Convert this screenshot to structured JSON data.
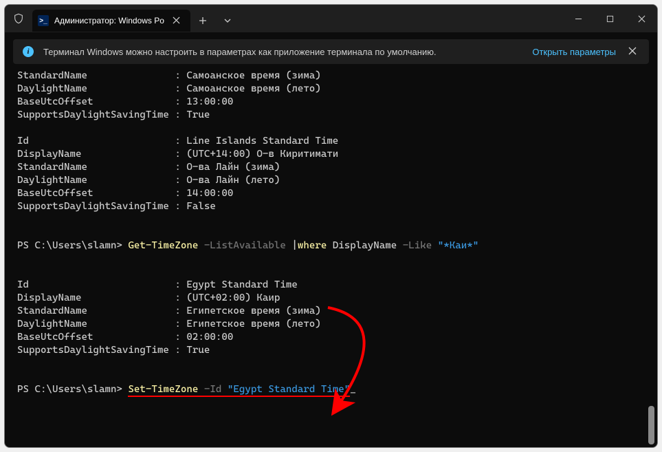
{
  "titlebar": {
    "tab_title": "Администратор: Windows Po",
    "tab_icon_glyph": ">_"
  },
  "banner": {
    "message": "Терминал Windows можно настроить в параметрах как приложение терминала по умолчанию.",
    "link": "Открыть параметры"
  },
  "terminal": {
    "block1": {
      "l1_k": "StandardName",
      "l1_v": "Самоанское время (зима)",
      "l2_k": "DaylightName",
      "l2_v": "Самоанское время (лето)",
      "l3_k": "BaseUtcOffset",
      "l3_v": "13:00:00",
      "l4_k": "SupportsDaylightSavingTime",
      "l4_v": "True"
    },
    "block2": {
      "l1_k": "Id",
      "l1_v": "Line Islands Standard Time",
      "l2_k": "DisplayName",
      "l2_v": "(UTC+14:00) О-в Киритимати",
      "l3_k": "StandardName",
      "l3_v": "О-ва Лайн (зима)",
      "l4_k": "DaylightName",
      "l4_v": "О-ва Лайн (лето)",
      "l5_k": "BaseUtcOffset",
      "l5_v": "14:00:00",
      "l6_k": "SupportsDaylightSavingTime",
      "l6_v": "False"
    },
    "cmd1": {
      "prompt": "PS C:\\Users\\slamn> ",
      "cmd": "Get-TimeZone",
      "arg1": " -ListAvailable ",
      "pipe": "|",
      "where": "where",
      "prop": " DisplayName ",
      "like": "-Like ",
      "str": "\"*Каи*\""
    },
    "block3": {
      "l1_k": "Id",
      "l1_v": "Egypt Standard Time",
      "l2_k": "DisplayName",
      "l2_v": "(UTC+02:00) Каир",
      "l3_k": "StandardName",
      "l3_v": "Египетское время (зима)",
      "l4_k": "DaylightName",
      "l4_v": "Египетское время (лето)",
      "l5_k": "BaseUtcOffset",
      "l5_v": "02:00:00",
      "l6_k": "SupportsDaylightSavingTime",
      "l6_v": "True"
    },
    "cmd2": {
      "prompt": "PS C:\\Users\\slamn> ",
      "cmd": "Set-TimeZone",
      "arg1": " -Id ",
      "str": "\"Egypt Standard Time\"",
      "cursor": "_"
    }
  }
}
